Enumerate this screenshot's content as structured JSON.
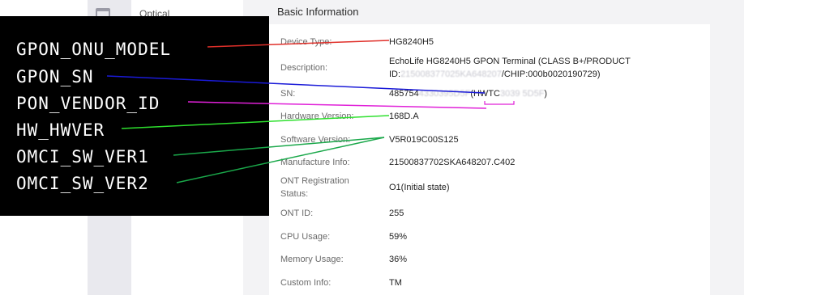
{
  "side_menu": {
    "item": "Optical"
  },
  "section": {
    "title": "Basic Information"
  },
  "rows": [
    {
      "label": "Device Type:",
      "value": "HG8240H5"
    },
    {
      "label": "Description:",
      "value_line1": "EchoLife HG8240H5 GPON Terminal (CLASS B+/PRODUCT",
      "value_line2_prefix": "ID:",
      "value_line2_blur": "215008377025KA648207",
      "value_line2_suffix": "/CHIP:000b0020190729)"
    },
    {
      "label": "SN:",
      "value_prefix": "485754",
      "value_blur1": "4330395D5F",
      "value_mid": "(HWTC",
      "value_blur2": "3039 5D5F",
      "value_suffix": ")"
    },
    {
      "label": "Hardware Version:",
      "value": "168D.A"
    },
    {
      "label": "Software Version:",
      "value": "V5R019C00S125"
    },
    {
      "label": "Manufacture Info:",
      "value": "21500837702SKA648207.C402"
    },
    {
      "label_line1": "ONT Registration",
      "label_line2": "Status:",
      "value": "O1(Initial state)"
    },
    {
      "label": "ONT ID:",
      "value": "255"
    },
    {
      "label": "CPU Usage:",
      "value": "59%"
    },
    {
      "label": "Memory Usage:",
      "value": "36%"
    },
    {
      "label": "Custom Info:",
      "value": "TM"
    }
  ],
  "overlay": {
    "labels": [
      "GPON_ONU_MODEL",
      "GPON_SN",
      "PON_VENDOR_ID",
      "HW_HWVER",
      "OMCI_SW_VER1",
      "OMCI_SW_VER2"
    ],
    "colors": [
      "#e0302a",
      "#1a1ad8",
      "#e020d8",
      "#2ee02e",
      "#1aa84a",
      "#1aa84a"
    ]
  }
}
